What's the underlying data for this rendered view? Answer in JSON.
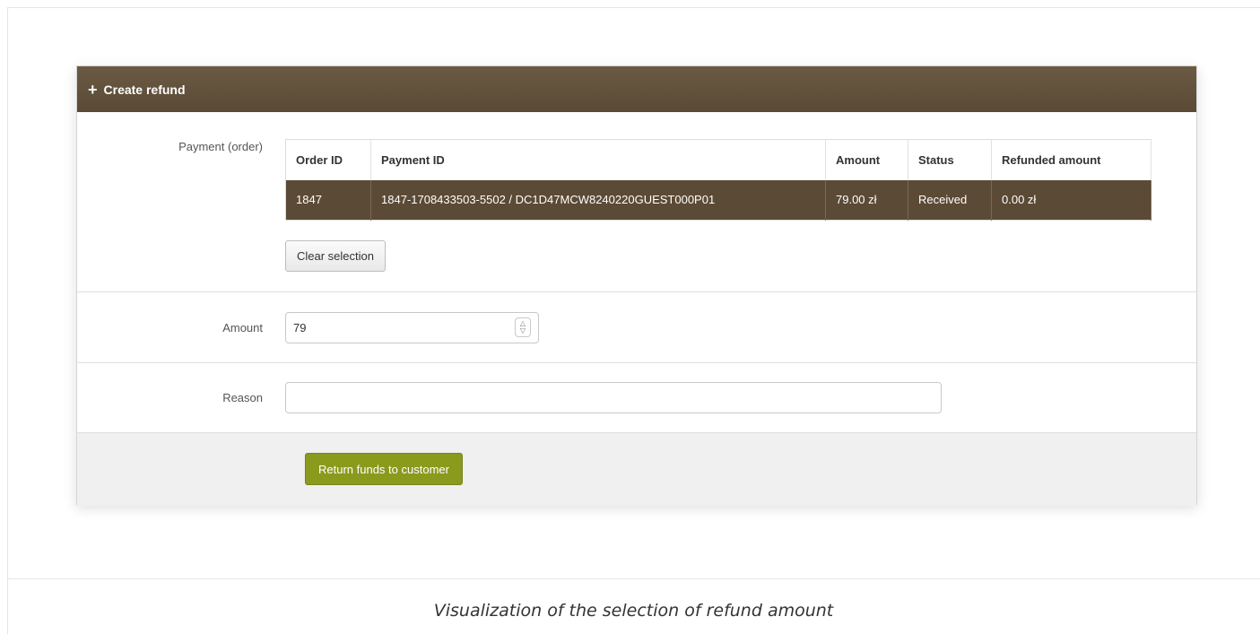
{
  "panel": {
    "title": "Create refund",
    "header_color": "#5e4d39"
  },
  "payment_row": {
    "label": "Payment (order)",
    "columns": [
      "Order ID",
      "Payment ID",
      "Amount",
      "Status",
      "Refunded amount"
    ],
    "rows": [
      {
        "order_id": "1847",
        "payment_id": "1847-1708433503-5502 / DC1D47MCW8240220GUEST000P01",
        "amount": "79.00 zł",
        "status": "Received",
        "refunded_amount": "0.00 zł"
      }
    ],
    "clear_button_label": "Clear selection"
  },
  "amount_row": {
    "label": "Amount",
    "value": "79"
  },
  "reason_row": {
    "label": "Reason",
    "value": ""
  },
  "footer": {
    "submit_label": "Return funds to customer",
    "submit_color": "#8a9a1d"
  },
  "caption": "Visualization of the selection of refund amount"
}
